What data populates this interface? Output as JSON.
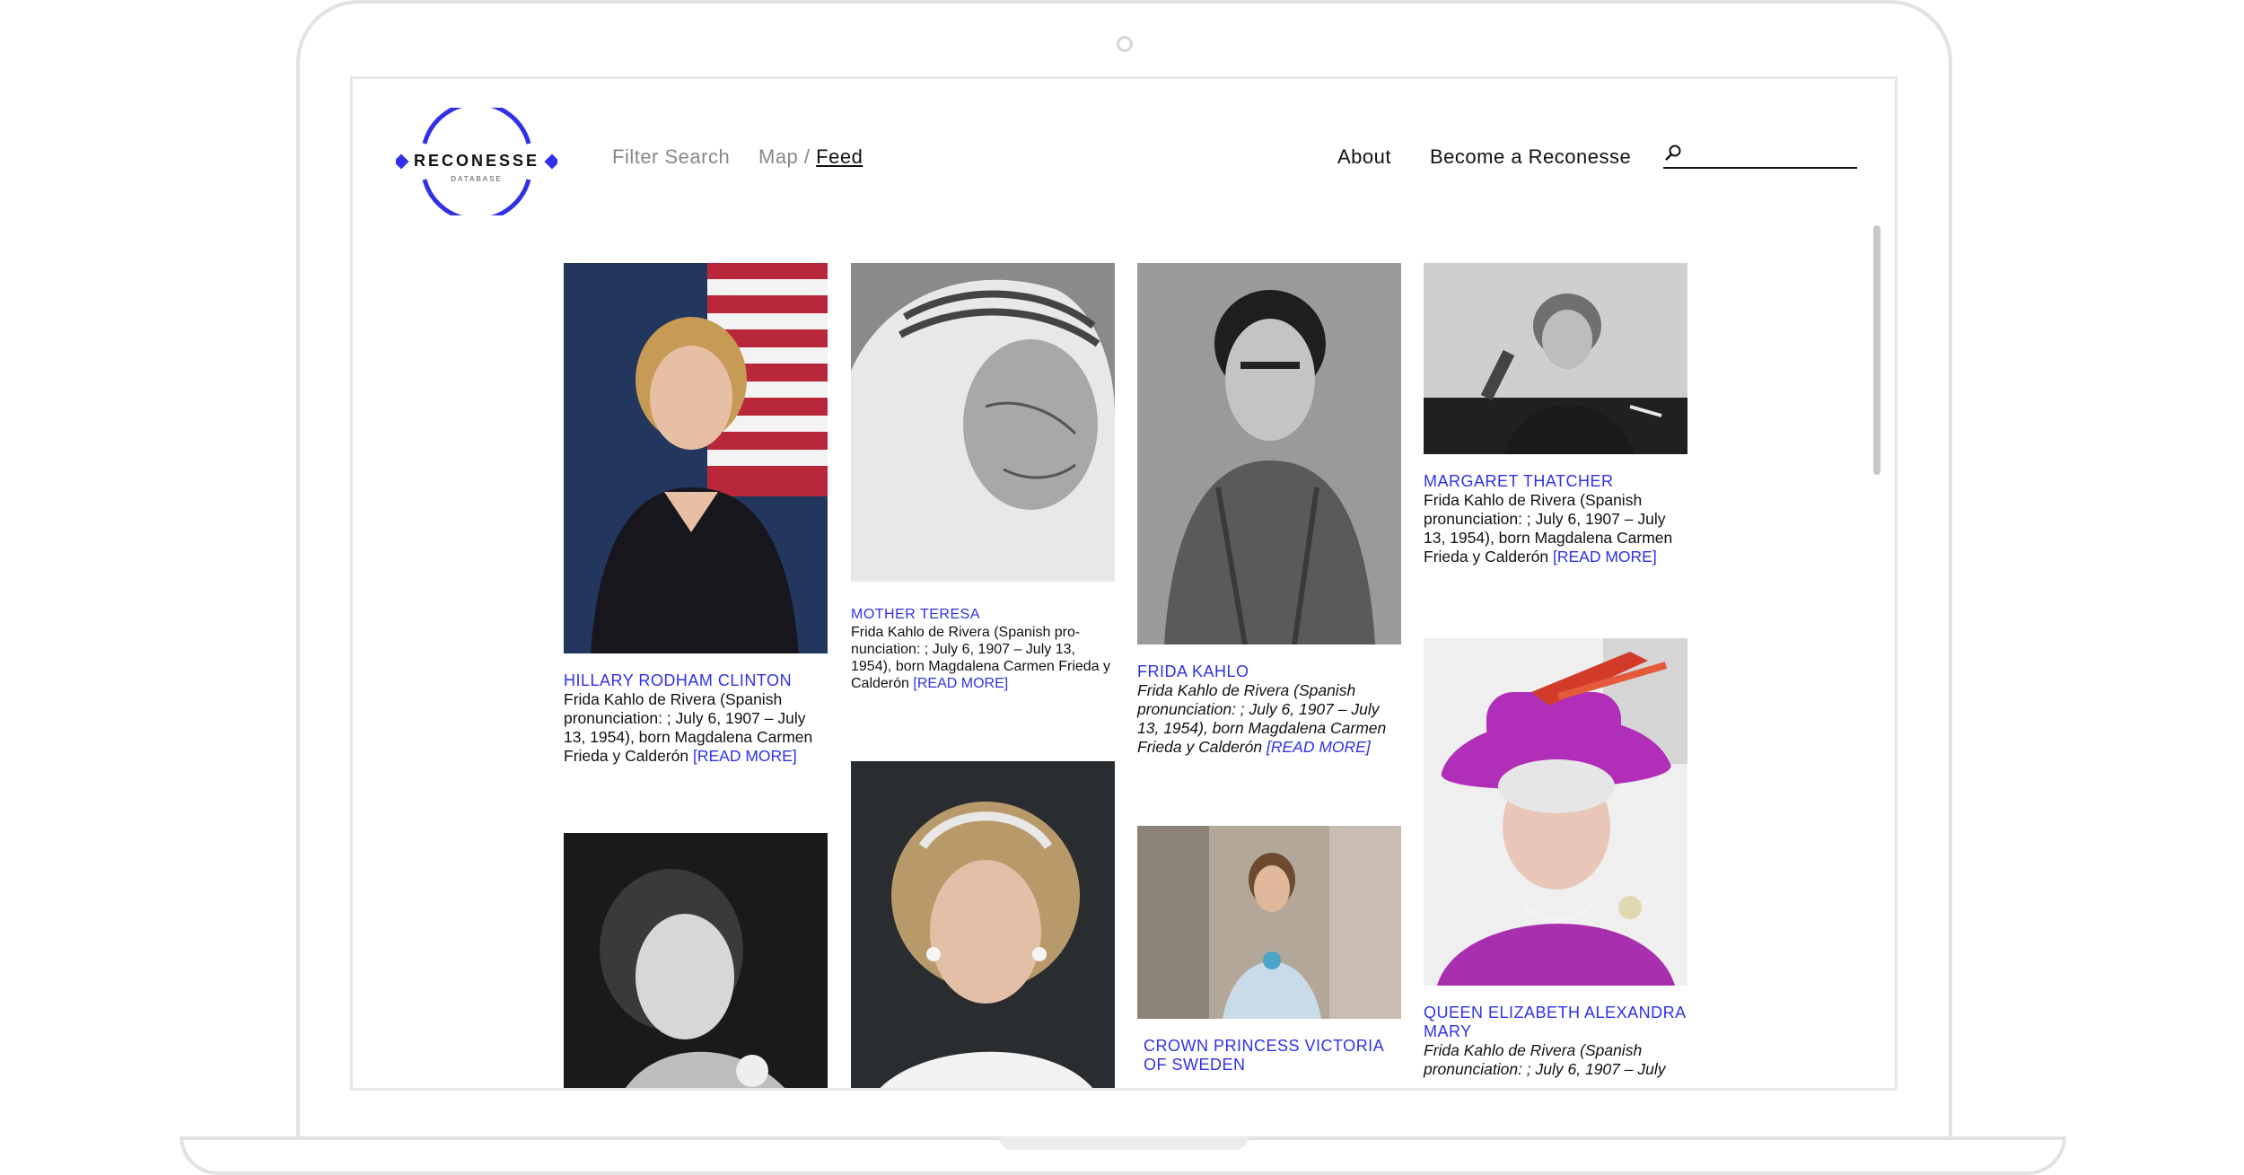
{
  "brand": {
    "name": "RECONESSE",
    "subtitle": "DATABASE",
    "accent_color": "#3030e8"
  },
  "nav": {
    "filter_search": "Filter Search",
    "map": "Map",
    "separator": "/",
    "feed": "Feed",
    "about": "About",
    "become": "Become a Reconesse"
  },
  "search": {
    "icon": "search-icon",
    "placeholder": ""
  },
  "cards": [
    {
      "name": "HILLARY RODHAM CLINTON",
      "desc": "Frida Kahlo de Rivera (Spanish pronunciation: ; July 6, 1907 – July 13, 1954), born Magdalena Carmen Frieda y Calderón",
      "more": "[READ MORE]"
    },
    {
      "name": "MOTHER TERESA",
      "desc": "Frida Kahlo de Rivera (Spanish pro-nunciation: ; July 6, 1907 – July 13, 1954), born Magdalena Carmen Frieda y Calderón",
      "more": "[READ MORE]"
    },
    {
      "name": "FRIDA KAHLO",
      "desc": "Frida Kahlo de Rivera (Spanish pronunciation: ; July 6, 1907 – July 13, 1954), born Magdalena Carmen Frieda y Calderón",
      "more": "[READ MORE]"
    },
    {
      "name": "MARGARET THATCHER",
      "desc": "Frida Kahlo de Rivera (Spanish pronunciation: ; July 6, 1907 – July 13, 1954), born Magdalena Carmen Frieda y Calderón",
      "more": "[READ MORE]"
    },
    {
      "name": "CROWN PRINCESS VICTORIA OF SWEDEN",
      "desc": "",
      "more": ""
    },
    {
      "name": "QUEEN ELIZABETH ALEXANDRA MARY",
      "desc": "Frida Kahlo de Rivera (Spanish pronunciation: ; July 6, 1907 – July",
      "more": ""
    }
  ]
}
